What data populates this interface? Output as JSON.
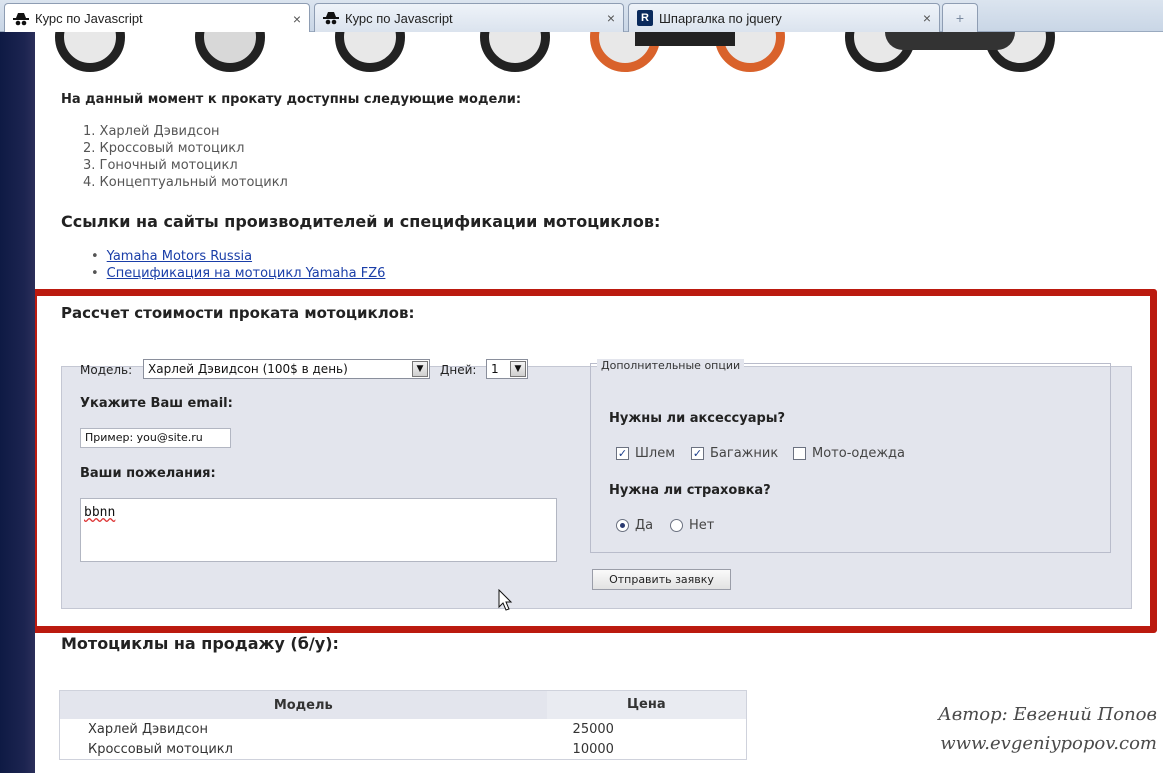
{
  "browser": {
    "tabs": [
      {
        "title": "Курс по Javascript",
        "close": "×",
        "active": true
      },
      {
        "title": "Курс по Javascript",
        "close": "×",
        "active": false
      },
      {
        "title": "Шпаргалка по jquery",
        "close": "×",
        "active": false,
        "icon_text": "R"
      }
    ],
    "new_tab": "+"
  },
  "content": {
    "available_heading": "На данный момент к прокату доступны следующие модели:",
    "models": [
      "1. Харлей Дэвидсон",
      "2. Кроссовый мотоцикл",
      "3. Гоночный мотоцикл",
      "4. Концептуальный мотоцикл"
    ],
    "links_heading": "Ссылки на сайты производителей и спецификации мотоциклов:",
    "links": [
      {
        "bullet": "•",
        "label": "Yamaha Motors Russia"
      },
      {
        "bullet": "•",
        "label": "Спецификация на мотоцикл Yamaha FZ6"
      }
    ]
  },
  "calc": {
    "title": "Рассчет стоимости проката мотоциклов:",
    "model_label": "Модель:",
    "model_value": "Харлей Дэвидсон (100$ в день)",
    "days_label": "Дней:",
    "days_value": "1",
    "email_label": "Укажите Ваш email:",
    "email_value": "Пример: you@site.ru",
    "wishes_label": "Ваши пожелания:",
    "wishes_value": "bbnn",
    "options_legend": "Дополнительные опции",
    "accessories_q": "Нужны ли аксессуары?",
    "accessories": [
      {
        "label": "Шлем",
        "checked": true
      },
      {
        "label": "Багажник",
        "checked": true
      },
      {
        "label": "Мото-одежда",
        "checked": false
      }
    ],
    "insurance_q": "Нужна ли страховка?",
    "insurance": [
      {
        "label": "Да",
        "selected": true
      },
      {
        "label": "Нет",
        "selected": false
      }
    ],
    "submit_label": "Отправить заявку",
    "check_mark": "✓",
    "arrow_glyph": "▼"
  },
  "sale": {
    "title": "Мотоциклы на продажу (б/у):",
    "columns": [
      "Модель",
      "Цена"
    ],
    "rows": [
      [
        "Харлей Дэвидсон",
        "25000"
      ],
      [
        "Кроссовый мотоцикл",
        "10000"
      ]
    ]
  },
  "watermark": {
    "line1": "Автор: Евгений Попов",
    "line2": "www.evgeniypopov.com"
  },
  "colors": {
    "highlight": "#bb1a0f",
    "form_bg": "#e3e5ed",
    "link": "#1a3ea8"
  }
}
